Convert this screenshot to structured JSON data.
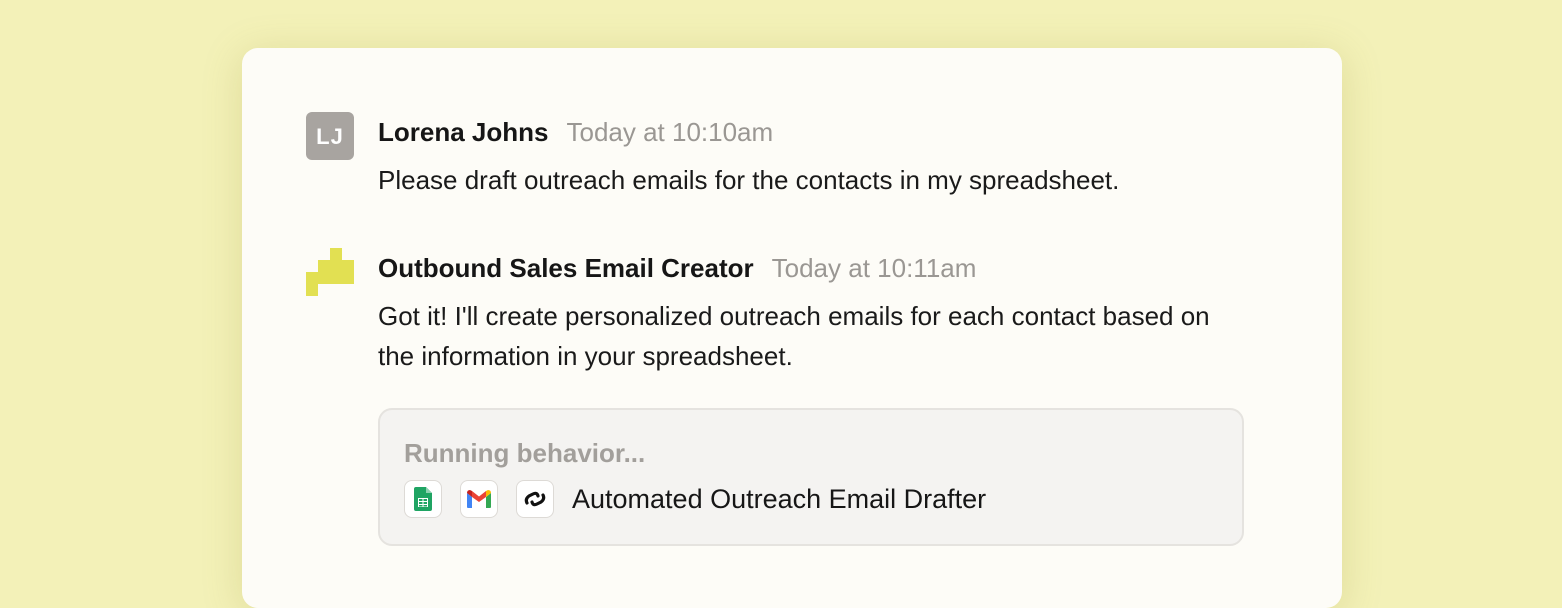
{
  "conversation": {
    "messages": [
      {
        "avatar_initials": "LJ",
        "sender": "Lorena Johns",
        "timestamp": "Today at 10:10am",
        "text": "Please draft outreach emails for the contacts in my spreadsheet."
      },
      {
        "avatar_icon": "agent-pixel-logo-icon",
        "sender": "Outbound Sales Email Creator",
        "timestamp": "Today at 10:11am",
        "text": "Got it! I'll create personalized outreach emails for each contact based on the information in your spreadsheet.",
        "behavior": {
          "status": "Running behavior...",
          "tools": [
            "google-sheets-icon",
            "gmail-icon",
            "link-chain-icon"
          ],
          "name": "Automated Outreach Email Drafter"
        }
      }
    ]
  },
  "colors": {
    "background": "#f3f1b8",
    "card": "#fdfcf7",
    "agent_accent": "#e2e052",
    "avatar": "#a8a4a0",
    "timestamp": "#9a9793"
  }
}
